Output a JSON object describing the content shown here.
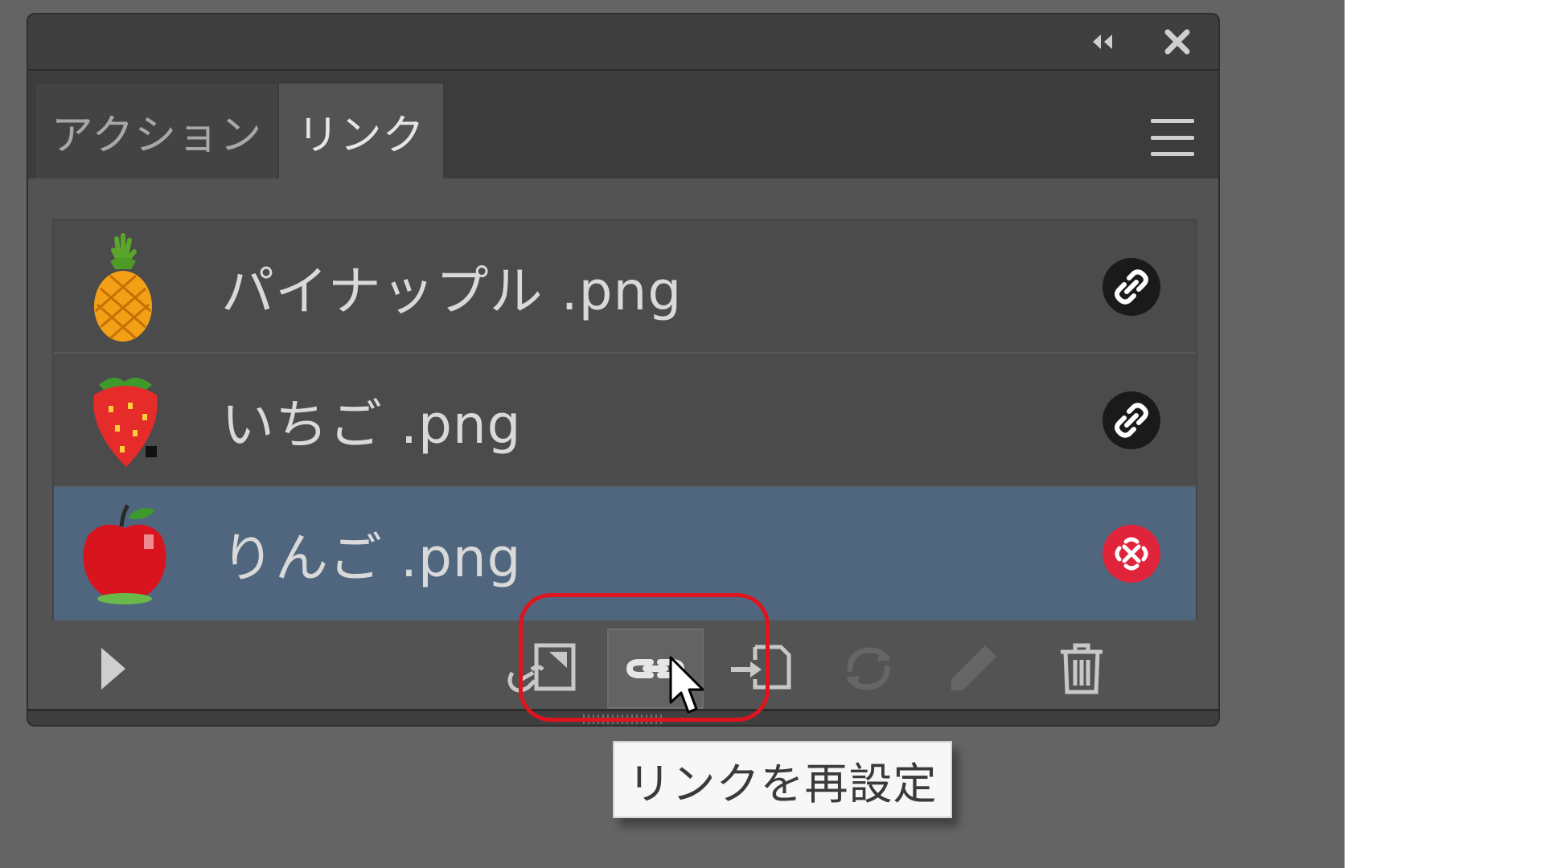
{
  "tabs": [
    {
      "label": "アクション",
      "active": false
    },
    {
      "label": "リンク",
      "active": true
    }
  ],
  "links": [
    {
      "name": "パイナップル .png",
      "icon": "pineapple-thumbnail",
      "status": "linked-icon",
      "selected": false
    },
    {
      "name": "いちご .png",
      "icon": "strawberry-thumbnail",
      "status": "linked-icon",
      "selected": false
    },
    {
      "name": "りんご .png",
      "icon": "apple-thumbnail",
      "status": "missing-link-icon",
      "selected": true
    }
  ],
  "toolbar": {
    "buttons": [
      "show-details-icon",
      "relink-icon",
      "go-to-link-icon",
      "update-link-icon",
      "edit-original-icon",
      "trash-icon"
    ]
  },
  "tooltip": {
    "text": "リンクを再設定"
  },
  "colors": {
    "selected_row": "#4f667e",
    "missing_status": "#e0243c",
    "highlight": "#e0141e"
  }
}
